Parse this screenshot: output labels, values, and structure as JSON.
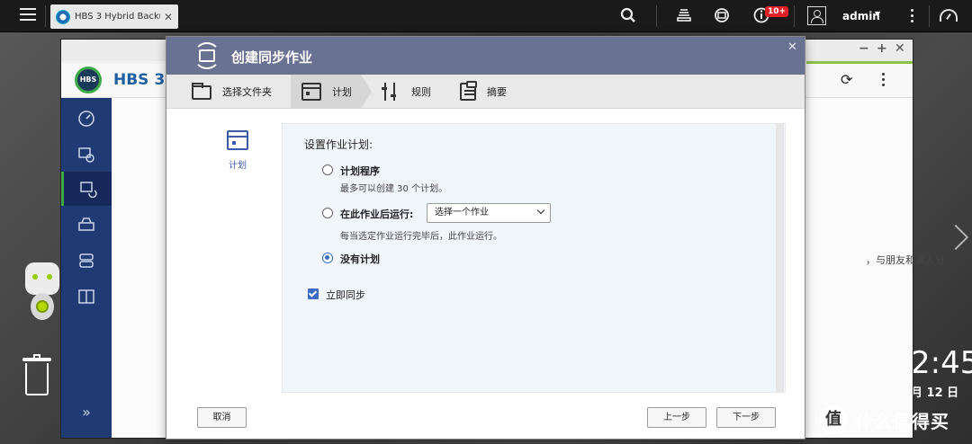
{
  "taskbar": {
    "tab_title": "HBS 3 Hybrid Backu...",
    "tab_close": "✕",
    "notification_badge": "10+",
    "user": "admin"
  },
  "hbs": {
    "app_name": "HBS 3",
    "logo_text": "HBS",
    "side_text": "，与朋友和家人分"
  },
  "desktop": {
    "clock_time": "2:45",
    "clock_date": "月 12 日",
    "watermark": "什么值得买",
    "watermark_logo": "值"
  },
  "dialog": {
    "title": "创建同步作业",
    "close": "✕",
    "steps": [
      {
        "label": "选择文件夹"
      },
      {
        "label": "计划"
      },
      {
        "label": "规则"
      },
      {
        "label": "摘要"
      }
    ],
    "left_label": "计划",
    "panel_title": "设置作业计划:",
    "options": {
      "schedule_label": "计划程序",
      "schedule_hint": "最多可以创建 30 个计划。",
      "after_job_label": "在此作业后运行:",
      "after_job_hint": "每当选定作业运行完毕后，此作业运行。",
      "after_job_select": "选择一个作业",
      "no_schedule_label": "没有计划",
      "selected": "没有计划"
    },
    "sync_now": {
      "label": "立即同步",
      "checked": true
    },
    "buttons": {
      "cancel": "取消",
      "prev": "上一步",
      "next": "下一步"
    }
  }
}
